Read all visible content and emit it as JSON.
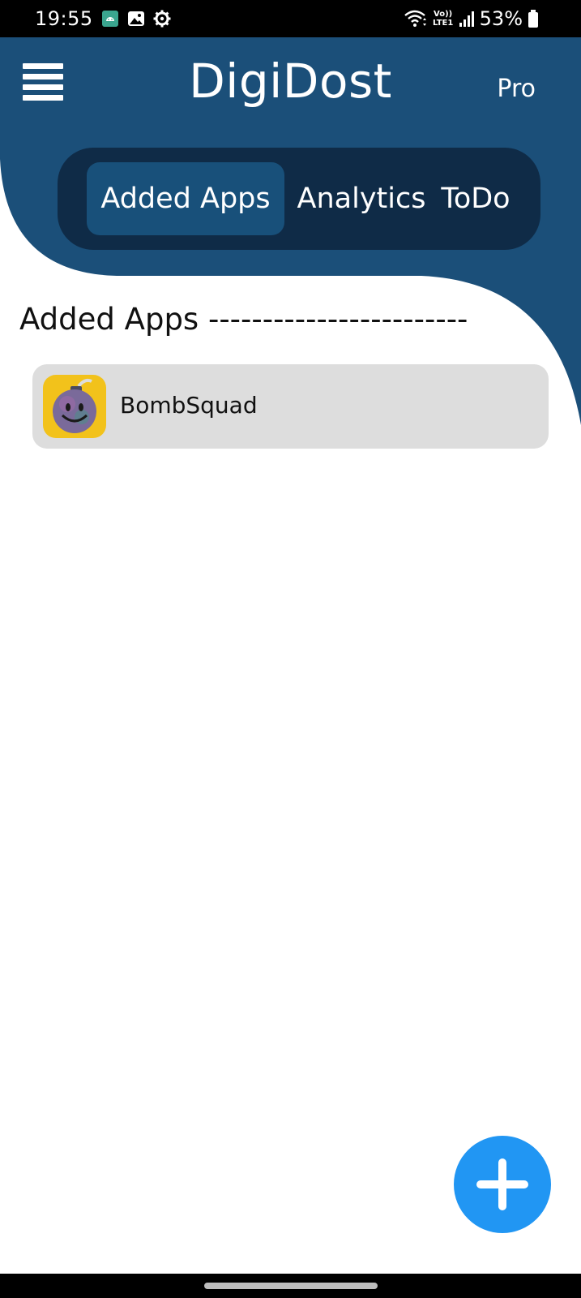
{
  "status_bar": {
    "time": "19:55",
    "network_label": "Vo)) LTE1",
    "battery": "53%",
    "icons": [
      "android-icon",
      "gallery-icon",
      "settings-gear-icon",
      "wifi-icon",
      "volte-icon",
      "signal-icon",
      "battery-icon"
    ]
  },
  "header": {
    "title": "DigiDost",
    "pro_label": "Pro",
    "colors": {
      "header_bg": "#1b4f79",
      "tab_bar_bg": "#0f2b47",
      "tab_active_bg": "#18507a"
    }
  },
  "tabs": [
    {
      "label": "Added Apps",
      "active": true
    },
    {
      "label": "Analytics",
      "active": false
    },
    {
      "label": "ToDo",
      "active": false
    }
  ],
  "section": {
    "title": "Added Apps ------------------------"
  },
  "apps": [
    {
      "name": "BombSquad",
      "icon": "bombsquad-app-icon"
    }
  ],
  "fab": {
    "icon": "plus-icon",
    "color": "#2196f3"
  }
}
